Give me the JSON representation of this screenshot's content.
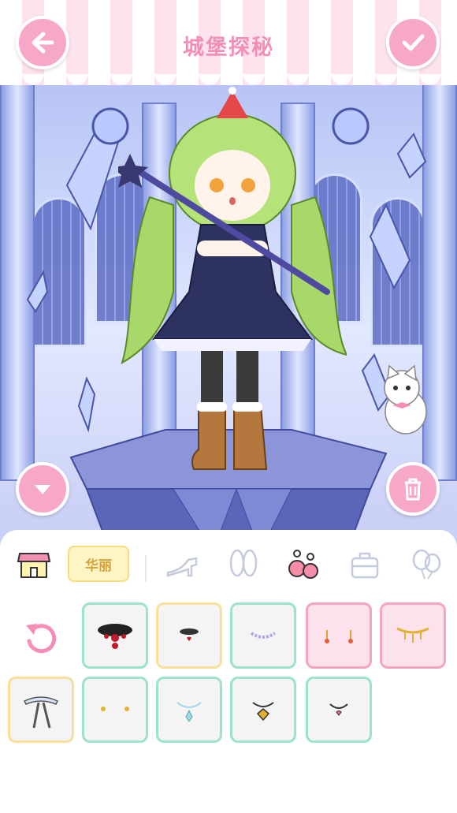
{
  "header": {
    "title": "城堡探秘",
    "back_icon": "arrow-left-icon",
    "confirm_icon": "checkmark-icon"
  },
  "scene": {
    "left_button_icon": "chevron-down-icon",
    "right_button_icon": "trash-icon"
  },
  "categories": {
    "selected_label": "华丽",
    "icons": [
      "shop-icon",
      "high-heel-icon",
      "bunny-ears-icon",
      "earrings-icon",
      "bag-icon",
      "balloon-icon"
    ]
  },
  "items": [
    {
      "icon": "reset-icon"
    },
    {
      "icon": "choker-icon"
    },
    {
      "icon": "necklace-heart-icon"
    },
    {
      "icon": "pearl-necklace-icon"
    },
    {
      "icon": "earrings-gold-icon"
    },
    {
      "icon": "gold-chain-necklace-icon"
    },
    {
      "icon": "ribbon-bow-icon"
    },
    {
      "icon": "stud-earrings-icon"
    },
    {
      "icon": "crystal-necklace-icon"
    },
    {
      "icon": "gold-pendant-icon"
    },
    {
      "icon": "heart-pendant-icon"
    }
  ],
  "colors": {
    "accent_pink": "#f7a8c8",
    "title_pink": "#f48eb8",
    "mint_border": "#9be3cf",
    "yellow_border": "#f7e09a",
    "pink_border": "#f5a4c2"
  }
}
